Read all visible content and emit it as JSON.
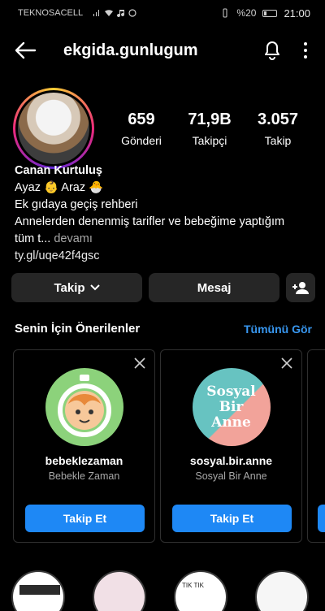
{
  "status_bar": {
    "carrier": "TEKNOSACELL",
    "battery_text": "%20",
    "time": "21:00"
  },
  "nav": {
    "username": "ekgida.gunlugum"
  },
  "stats": [
    {
      "value": "659",
      "label": "Gönderi"
    },
    {
      "value": "71,9B",
      "label": "Takipçi"
    },
    {
      "value": "3.057",
      "label": "Takip"
    }
  ],
  "bio": {
    "name": "Canan Kurtuluş",
    "line1": "Ayaz 👶 Araz 🐣",
    "line2": "Ek gıdaya geçiş rehberi",
    "line3": "Annelerden denenmiş tarifler ve bebeğime yaptığım",
    "line4_start": "tüm t...",
    "more": "devamı",
    "link": "ty.gl/uqe42f4gsc"
  },
  "actions": {
    "follow_label": "Takip",
    "message_label": "Mesaj"
  },
  "suggestions": {
    "title": "Senin İçin Önerilenler",
    "see_all": "Tümünü Gör",
    "cards": [
      {
        "username": "bebeklezaman",
        "name": "Bebekle Zaman",
        "button": "Takip Et"
      },
      {
        "username": "sosyal.bir.anne",
        "name": "Sosyal Bir Anne",
        "button": "Takip Et",
        "avatar_text": "Sosyal Bir Anne"
      }
    ]
  },
  "highlights": {
    "items": [
      {
        "tag": ""
      },
      {
        "tag": ""
      },
      {
        "tag": "TIK TIK"
      },
      {
        "tag": ""
      },
      {
        "tag": ""
      }
    ]
  },
  "colors": {
    "accent": "#1e88f5",
    "link_blue": "#3897f0",
    "button_dark": "#262626",
    "background": "#000000"
  }
}
